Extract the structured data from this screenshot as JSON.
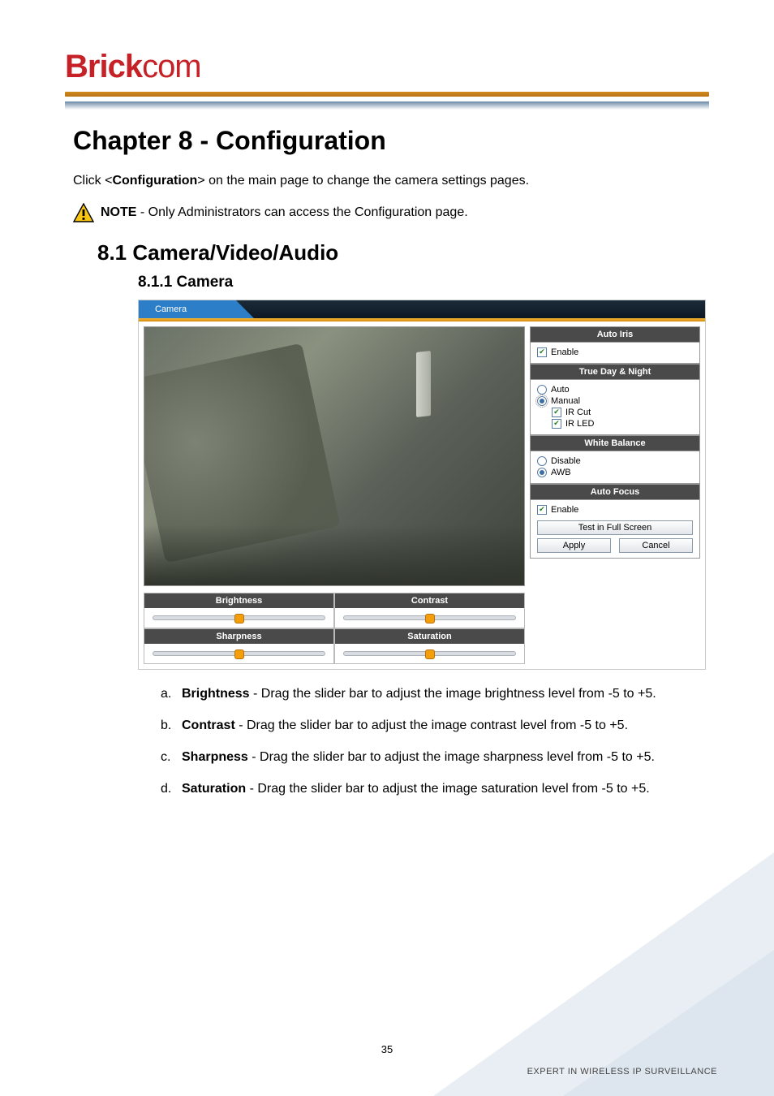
{
  "brand": {
    "bold": "Brick",
    "thin": "com"
  },
  "chapter": {
    "title": "Chapter 8 -  Configuration"
  },
  "intro": {
    "prefix": "Click <",
    "conf": "Configuration",
    "suffix": "> on the main page to change the camera settings pages."
  },
  "note": {
    "label": "NOTE",
    "text": " - Only Administrators can access the Configuration page."
  },
  "section": {
    "num_title": "8.1  Camera/Video/Audio"
  },
  "subsection": {
    "num_title": "8.1.1   Camera"
  },
  "ui": {
    "tab": "Camera",
    "sliders": {
      "brightness": {
        "label": "Brightness",
        "pos_pct": 50
      },
      "contrast": {
        "label": "Contrast",
        "pos_pct": 50
      },
      "sharpness": {
        "label": "Sharpness",
        "pos_pct": 50
      },
      "saturation": {
        "label": "Saturation",
        "pos_pct": 50
      }
    },
    "auto_iris": {
      "title": "Auto Iris",
      "enable": "Enable",
      "enable_checked": true
    },
    "true_dn": {
      "title": "True Day & Night",
      "auto": "Auto",
      "auto_selected": false,
      "manual": "Manual",
      "manual_selected": true,
      "ir_cut": "IR Cut",
      "ir_cut_checked": true,
      "ir_led": "IR LED",
      "ir_led_checked": true
    },
    "white_balance": {
      "title": "White Balance",
      "disable": "Disable",
      "disable_selected": false,
      "awb": "AWB",
      "awb_selected": true
    },
    "auto_focus": {
      "title": "Auto Focus",
      "enable": "Enable",
      "enable_checked": true
    },
    "buttons": {
      "test_full": "Test in Full Screen",
      "apply": "Apply",
      "cancel": "Cancel"
    }
  },
  "list": {
    "a": {
      "m": "a.",
      "term": "Brightness",
      "rest": " - Drag the slider bar to adjust the image brightness level from -5 to +5."
    },
    "b": {
      "m": "b.",
      "term": "Contrast",
      "rest": " - Drag the slider bar to adjust the image contrast level from -5 to +5."
    },
    "c": {
      "m": "c.",
      "term": "Sharpness",
      "rest": " - Drag the slider bar to adjust the image sharpness level from -5 to +5."
    },
    "d": {
      "m": "d.",
      "term": "Saturation",
      "rest": " - Drag the slider bar to adjust the image saturation level from -5 to +5."
    }
  },
  "page_number": "35",
  "footer": "EXPERT IN WIRELESS IP SURVEILLANCE"
}
